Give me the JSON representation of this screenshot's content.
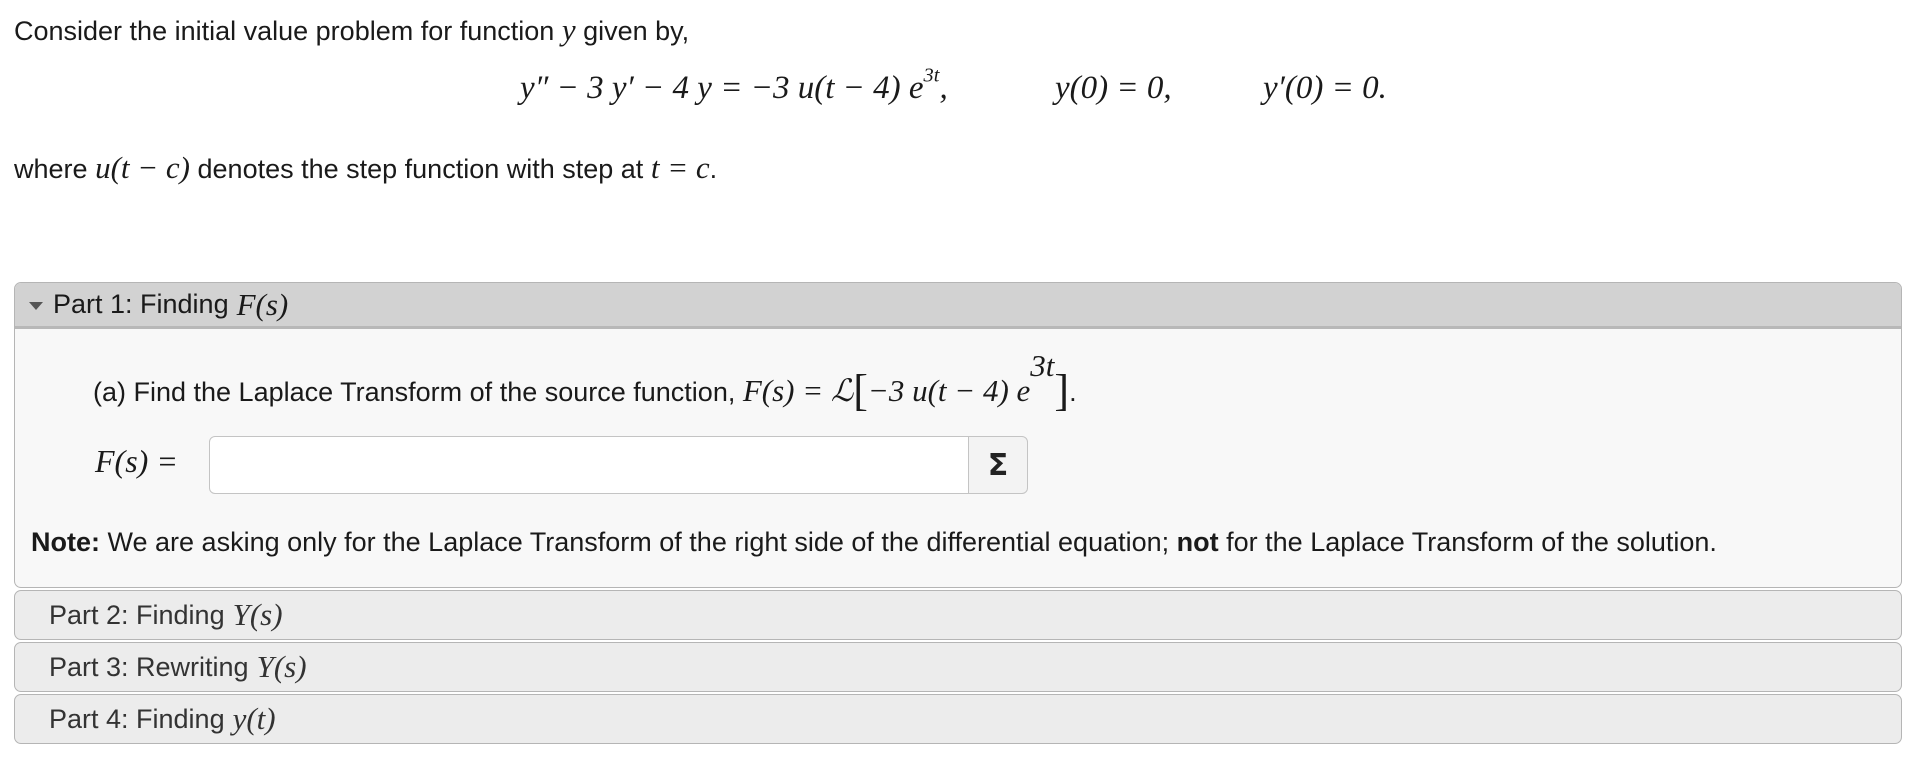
{
  "intro": {
    "text": "Consider the initial value problem for function",
    "var": "y",
    "suffix": "given by,"
  },
  "equation": {
    "main_lhs": "y″ − 3 y′ − 4 y = −3 u(t − 4) e",
    "main_exp": "3t",
    "main_end": ",",
    "ic1": "y(0) = 0,",
    "ic2": "y′(0) = 0."
  },
  "where": {
    "prefix": "where",
    "func": "u(t − c)",
    "middle": "denotes the step function with step at",
    "eq": "t = c",
    "end": "."
  },
  "part1": {
    "label": "Part 1: Finding",
    "math": "F(s)",
    "question_text": "(a) Find the Laplace Transform of the source function,",
    "question_math": "F(s) = ℒ",
    "question_inner": "−3 u(t − 4) e",
    "question_exp": "3t",
    "answer_label": "F(s) =",
    "answer_value": "",
    "sigma_label": "Σ",
    "note_bold": "Note:",
    "note_text1": "We are asking only for the Laplace Transform of the right side of the differential equation;",
    "note_not": "not",
    "note_text2": "for the Laplace Transform of the solution."
  },
  "parts": [
    {
      "label": "Part 2: Finding",
      "math": "Y(s)"
    },
    {
      "label": "Part 3: Rewriting",
      "math": "Y(s)"
    },
    {
      "label": "Part 4: Finding",
      "math": "y(t)"
    }
  ]
}
